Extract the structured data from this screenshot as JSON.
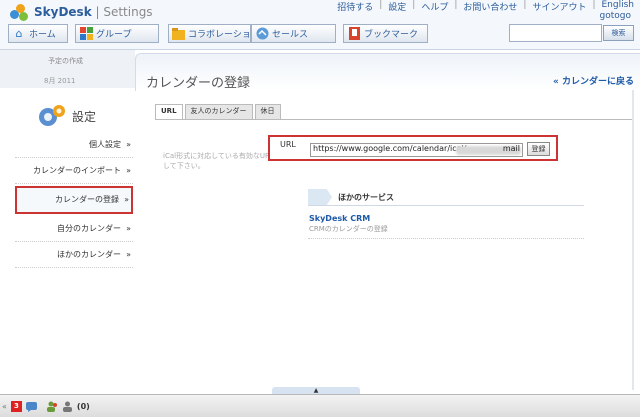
{
  "app": {
    "name": "SkyDesk",
    "section": "Settings"
  },
  "top_links": [
    "招待する",
    "設定",
    "ヘルプ",
    "お問い合わせ",
    "サインアウト",
    "English"
  ],
  "user": {
    "name": "gotogo"
  },
  "nav": [
    {
      "label": "ホーム",
      "icon": "home-icon"
    },
    {
      "label": "グループ",
      "icon": "group-icon"
    },
    {
      "label": "コラボレーション",
      "icon": "collaboration-icon"
    },
    {
      "label": "セールス",
      "icon": "sales-icon"
    },
    {
      "label": "ブックマーク",
      "icon": "bookmark-icon"
    }
  ],
  "search": {
    "placeholder": "",
    "button": "検索"
  },
  "left_strip": {
    "line1": "予定の作成",
    "line2": "8月 2011"
  },
  "page": {
    "title": "カレンダーの登録",
    "back_link": "« カレンダーに戻る"
  },
  "settings": {
    "title": "設定",
    "items": [
      {
        "label": "個人設定",
        "arrow": "»"
      },
      {
        "label": "カレンダーのインポート",
        "arrow": "»"
      },
      {
        "label": "カレンダーの登録",
        "arrow": "»",
        "active": true
      },
      {
        "label": "自分のカレンダー",
        "arrow": "»"
      },
      {
        "label": "ほかのカレンダー",
        "arrow": "»"
      }
    ]
  },
  "tabs": [
    {
      "label": "URL",
      "active": true
    },
    {
      "label": "友人のカレンダー"
    },
    {
      "label": "休日"
    }
  ],
  "form": {
    "help_text": "iCal形式に対応している有効なURLを入力して下さい。",
    "url_label": "URL",
    "url_value": "https://www.google.com/calendar/ical/",
    "url_value_end": "mail",
    "submit_label": "登録"
  },
  "other_services": {
    "heading": "ほかのサービス",
    "link": "SkyDesk CRM",
    "desc": "CRMのカレンダーの登録"
  },
  "bottom_bar": {
    "badge": "3",
    "count": "(0)",
    "handle": "▲"
  },
  "colors": {
    "accent": "#1d5aa8",
    "highlight": "#cc3333",
    "header_bg": "#f4f7fb"
  }
}
